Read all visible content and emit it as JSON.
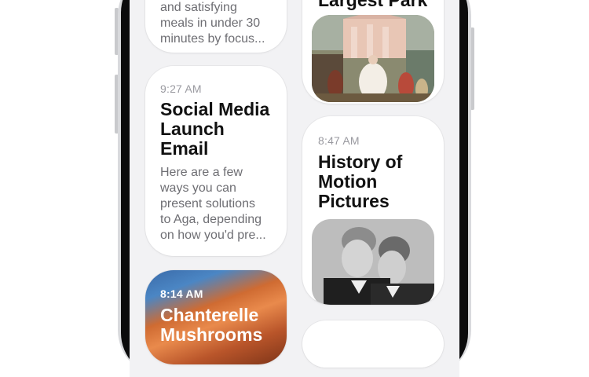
{
  "notes": [
    {
      "time": "",
      "title": "",
      "excerpt_lines": [
        "and satisfying",
        "meals in under 30",
        "minutes by focus..."
      ]
    },
    {
      "time": "9:27 AM",
      "title_lines": [
        "Social Media",
        "Launch",
        "Email"
      ],
      "excerpt_lines": [
        "Here are a few",
        "ways you can",
        "present solutions",
        "to Aga, depending",
        "on how you'd pre..."
      ]
    },
    {
      "time": "8:14 AM",
      "title_lines": [
        "Chanterelle",
        "Mushrooms"
      ]
    },
    {
      "time": "",
      "title_lines": [
        "Largest Park"
      ],
      "image": "painting-thumbnail"
    },
    {
      "time": "8:47 AM",
      "title_lines": [
        "History of",
        "Motion",
        "Pictures"
      ],
      "image": "photo-thumbnail"
    }
  ],
  "colors": {
    "screen_bg": "#f2f2f4",
    "card_bg": "#ffffff",
    "time_text": "#9a9aa0",
    "excerpt_text": "#6e6e73",
    "title_text": "#111111"
  }
}
